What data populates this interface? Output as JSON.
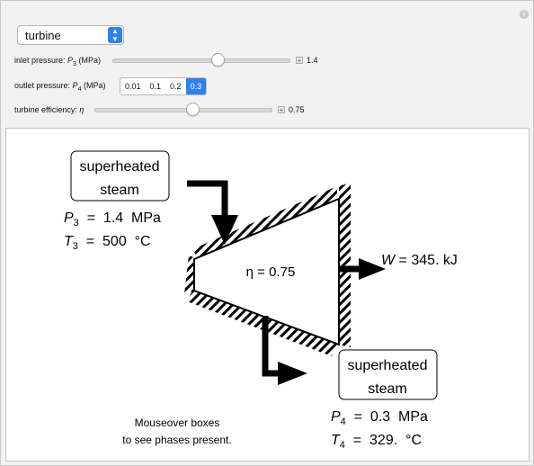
{
  "dropdown": {
    "selected": "turbine"
  },
  "controls": {
    "inlet": {
      "label_prefix": "inlet pressure: ",
      "var": "P",
      "sub": "3",
      "unit": " (MPa)",
      "value": "1.4"
    },
    "outlet": {
      "label_prefix": "outlet pressure: ",
      "var": "P",
      "sub": "4",
      "unit": " (MPa)",
      "options": [
        "0.01",
        "0.1",
        "0.2",
        "0.3"
      ],
      "selected": "0.3"
    },
    "efficiency": {
      "label_prefix": "turbine efficiency: ",
      "var": "η",
      "value": "0.75"
    }
  },
  "diagram": {
    "inlet_box": {
      "line1": "superheated",
      "line2": "steam"
    },
    "inlet_state": {
      "p_var": "P",
      "p_sub": "3",
      "p_val": "  =  1.4  MPa",
      "t_var": "T",
      "t_sub": "3",
      "t_val": "  =  500  °C"
    },
    "eta_text": "η = 0.75",
    "work": {
      "var": "W",
      "val": " = 345. kJ"
    },
    "outlet_box": {
      "line1": "superheated",
      "line2": "steam"
    },
    "outlet_state": {
      "p_var": "P",
      "p_sub": "4",
      "p_val": "  =  0.3  MPa",
      "t_var": "T",
      "t_sub": "4",
      "t_val": "  =  329.  °C"
    },
    "note": {
      "line1": "Mouseover boxes",
      "line2": "to see phases present."
    }
  },
  "icons": {
    "corner": "plus-icon",
    "dropdown": "chevron-updown-icon"
  }
}
